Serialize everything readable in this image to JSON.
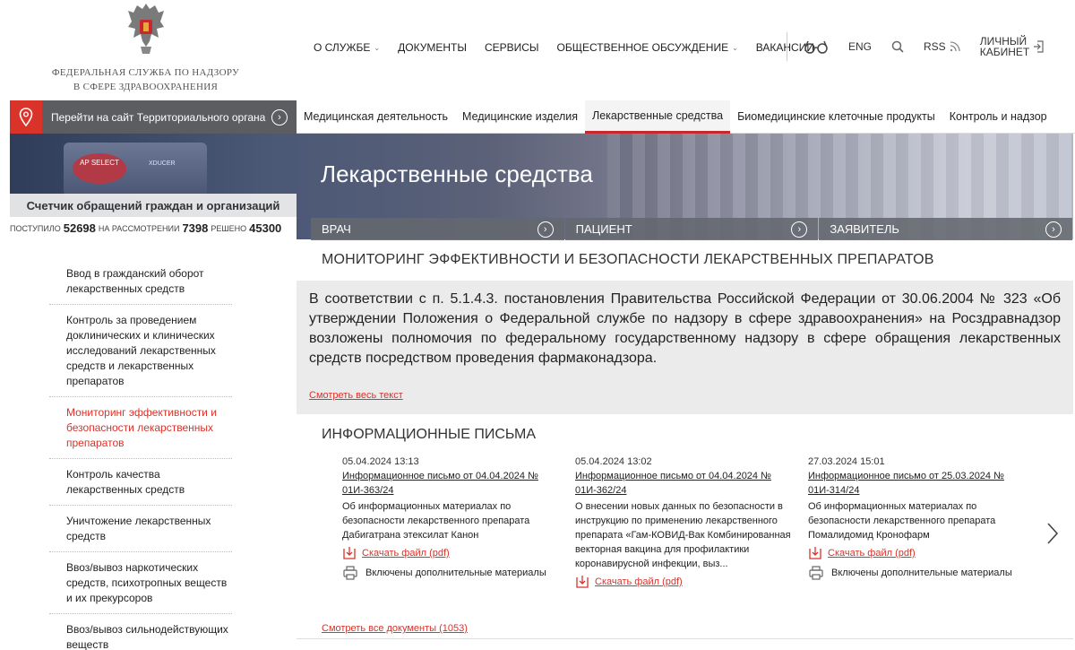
{
  "header": {
    "agency_name_line1": "Федеральная служба по надзору",
    "agency_name_line2": "в сфере здравоохранения",
    "nav": [
      {
        "label": "О службе",
        "has_dropdown": true
      },
      {
        "label": "Документы",
        "has_dropdown": false
      },
      {
        "label": "Сервисы",
        "has_dropdown": false
      },
      {
        "label": "Общественное обсуждение",
        "has_dropdown": true
      },
      {
        "label": "Вакансии",
        "has_dropdown": false
      }
    ],
    "utility": {
      "lang": "ENG",
      "rss": "RSS",
      "cabinet_line1": "Личный",
      "cabinet_line2": "кабинет"
    }
  },
  "region": {
    "label": "Перейти на сайт Территориального органа"
  },
  "category_tabs": [
    {
      "label": "Медицинская деятельность",
      "active": false
    },
    {
      "label": "Медицинские изделия",
      "active": false
    },
    {
      "label": "Лекарственные средства",
      "active": true
    },
    {
      "label": "Биомедицинские клеточные продукты",
      "active": false
    },
    {
      "label": "Контроль и надзор",
      "active": false
    }
  ],
  "banner": {
    "title": "Лекарственные средства",
    "device_label_1": "AP SELECT",
    "device_label_2": "XDUCER"
  },
  "counter": {
    "title": "Счетчик обращений граждан и организаций",
    "received_label": "поступило",
    "received": "52698",
    "review_label": "на рассмотрении",
    "review": "7398",
    "resolved_label": "решено",
    "resolved": "45300"
  },
  "roles": [
    {
      "label": "Врач"
    },
    {
      "label": "Пациент"
    },
    {
      "label": "Заявитель"
    }
  ],
  "sidebar": {
    "items": [
      {
        "label": "Ввод в гражданский оборот лекарственных средств",
        "active": false
      },
      {
        "label": "Контроль за проведением доклинических и клинических исследований лекарственных средств и лекарственных препаратов",
        "active": false
      },
      {
        "label": "Мониторинг эффективности и безопасности лекарственных препаратов",
        "active": true
      },
      {
        "label": "Контроль качества лекарственных средств",
        "active": false
      },
      {
        "label": "Уничтожение лекарственных средств",
        "active": false
      },
      {
        "label": "Ввоз/вывоз наркотических средств, психотропных веществ и их прекурсоров",
        "active": false
      },
      {
        "label": "Ввоз/вывоз сильнодействующих веществ",
        "active": false
      }
    ]
  },
  "main": {
    "heading": "Мониторинг эффективности и безопасности лекарственных препаратов",
    "intro": "В соответствии с п. 5.1.4.3. постановления Правительства Российской Федерации от 30.06.2004 № 323 «Об утверждении Положения о Федеральной службе по надзору в сфере здравоохранения» на Росздравнадзор возложены полномочия по федеральному государственному надзору в сфере обращения лекарственных средств посредством проведения фармаконадзора.",
    "more_link": "Смотреть весь текст",
    "letters_heading": "Информационные письма",
    "letters": [
      {
        "date": "05.04.2024 13:13",
        "title": "Информационное письмо от 04.04.2024 № 01И-363/24",
        "desc": "Об информационных материалах по безопасности лекарственного препарата Дабигатрана этексилат Канон",
        "download": "Скачать файл (pdf)",
        "extra": "Включены дополнительные материалы"
      },
      {
        "date": "05.04.2024 13:02",
        "title": "Информационное письмо от 04.04.2024 № 01И-362/24",
        "desc": "О внесении новых данных по безопасности в инструкцию по применению лекарственного препарата «Гам-КОВИД-Вак Комбинированная векторная вакцина для профилактики коронавирусной инфекции, выз...",
        "download": "Скачать файл (pdf)",
        "extra": ""
      },
      {
        "date": "27.03.2024 15:01",
        "title": "Информационное письмо от 25.03.2024 № 01И-314/24",
        "desc": "Об информационных материалах по безопасности лекарственного препарата Помалидомид Кронофарм",
        "download": "Скачать файл (pdf)",
        "extra": "Включены дополнительные материалы"
      }
    ],
    "all_docs": "Смотреть все документы (1053)"
  },
  "colors": {
    "accent_red": "#d9332a",
    "tab_active_border": "#c8282b",
    "region_bar": "#5b5d60",
    "intro_bg": "#ebebeb"
  }
}
